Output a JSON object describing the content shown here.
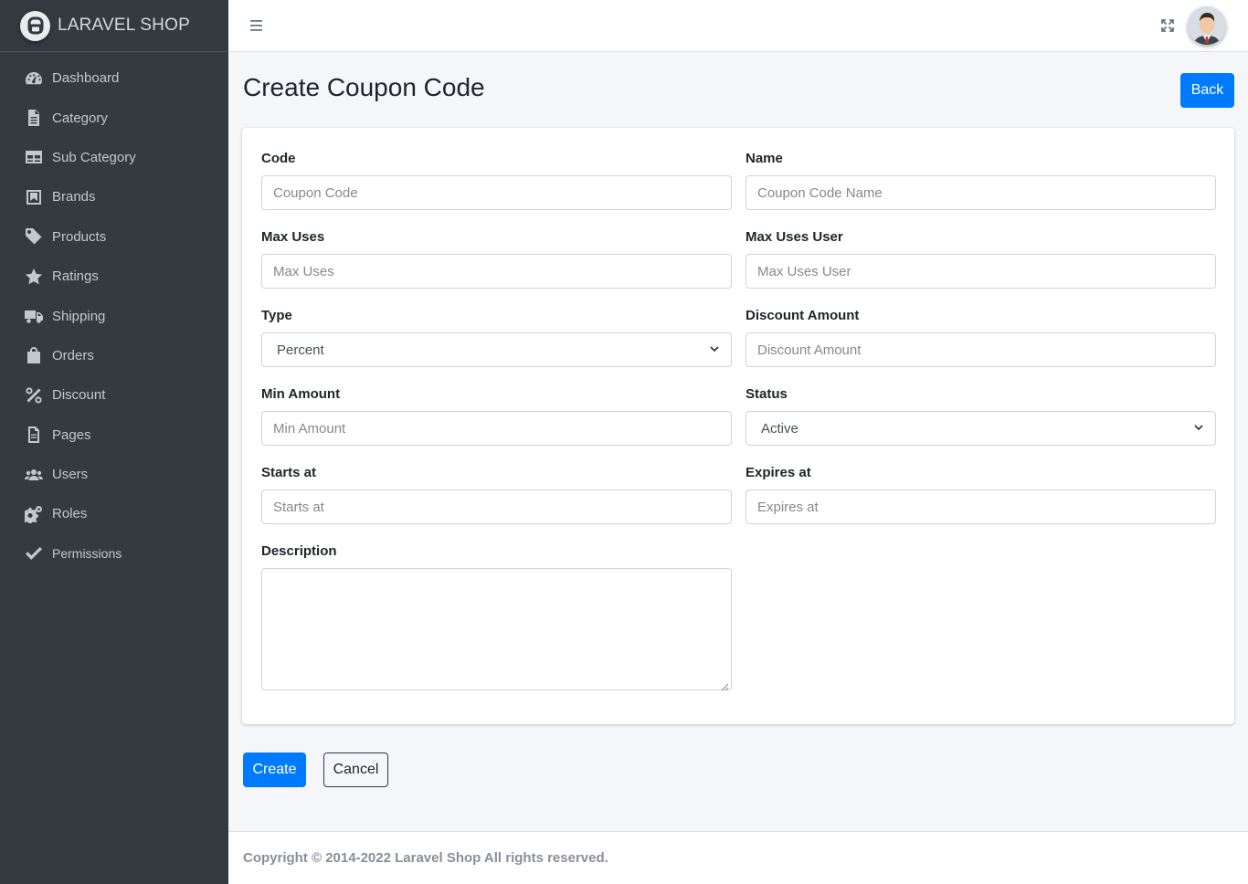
{
  "brand": {
    "name": "LARAVEL SHOP"
  },
  "sidebar": {
    "items": [
      {
        "label": "Dashboard",
        "icon": "dashboard-icon"
      },
      {
        "label": "Category",
        "icon": "file-icon"
      },
      {
        "label": "Sub Category",
        "icon": "table-icon"
      },
      {
        "label": "Brands",
        "icon": "bookmark-icon"
      },
      {
        "label": "Products",
        "icon": "tag-icon"
      },
      {
        "label": "Ratings",
        "icon": "star-icon"
      },
      {
        "label": "Shipping",
        "icon": "truck-icon"
      },
      {
        "label": "Orders",
        "icon": "shopping-bag-icon"
      },
      {
        "label": "Discount",
        "icon": "percent-icon"
      },
      {
        "label": "Pages",
        "icon": "file-alt-icon"
      },
      {
        "label": "Users",
        "icon": "users-icon"
      },
      {
        "label": "Roles",
        "icon": "cogs-icon"
      },
      {
        "label": "Permissions",
        "icon": "check-icon"
      }
    ]
  },
  "header": {
    "title": "Create Coupon Code",
    "back_label": "Back"
  },
  "form": {
    "code": {
      "label": "Code",
      "placeholder": "Coupon Code"
    },
    "name": {
      "label": "Name",
      "placeholder": "Coupon Code Name"
    },
    "max_uses": {
      "label": "Max Uses",
      "placeholder": "Max Uses"
    },
    "max_uses_user": {
      "label": "Max Uses User",
      "placeholder": "Max Uses User"
    },
    "type": {
      "label": "Type",
      "selected": "Percent"
    },
    "discount_amount": {
      "label": "Discount Amount",
      "placeholder": "Discount Amount"
    },
    "min_amount": {
      "label": "Min Amount",
      "placeholder": "Min Amount"
    },
    "status": {
      "label": "Status",
      "selected": "Active"
    },
    "starts_at": {
      "label": "Starts at",
      "placeholder": "Starts at"
    },
    "expires_at": {
      "label": "Expires at",
      "placeholder": "Expires at"
    },
    "description": {
      "label": "Description",
      "value": ""
    }
  },
  "actions": {
    "create_label": "Create",
    "cancel_label": "Cancel"
  },
  "footer": {
    "text": "Copyright © 2014-2022 Laravel Shop All rights reserved."
  },
  "colors": {
    "sidebar_bg": "#343a40",
    "primary": "#007bff",
    "page_bg": "#f4f6f9"
  }
}
